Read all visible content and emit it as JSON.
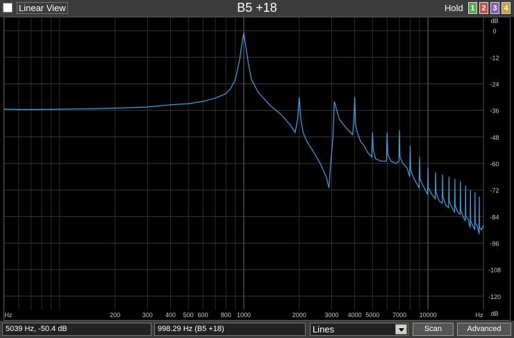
{
  "window": {
    "title": "B5 +18"
  },
  "toolbar": {
    "linear_view_label": "Linear View",
    "hold_label": "Hold",
    "hold_buttons": [
      {
        "label": "1",
        "color": "#5aa650"
      },
      {
        "label": "2",
        "color": "#c0504d"
      },
      {
        "label": "3",
        "color": "#7a60b0"
      },
      {
        "label": "4",
        "color": "#c9a03c"
      }
    ]
  },
  "chart_data": {
    "type": "line",
    "x_scale": "log",
    "xlim": [
      50,
      20000
    ],
    "ylim": [
      -126,
      6
    ],
    "x_tick_labels": [
      "Hz",
      "200",
      "300",
      "400",
      "500",
      "600",
      "800",
      "1000",
      "2000",
      "3000",
      "4000",
      "5000",
      "7000",
      "10000",
      "Hz"
    ],
    "x_tick_values": [
      null,
      200,
      300,
      400,
      500,
      600,
      800,
      1000,
      2000,
      3000,
      4000,
      5000,
      7000,
      10000,
      null
    ],
    "y_tick_labels": [
      "dB",
      "0",
      "-12",
      "-24",
      "-36",
      "-48",
      "-60",
      "-72",
      "-84",
      "-96",
      "-108",
      "-120",
      "dB"
    ],
    "y_tick_values": [
      null,
      0,
      -12,
      -24,
      -36,
      -48,
      -60,
      -72,
      -84,
      -96,
      -108,
      -120,
      null
    ],
    "grid": true,
    "line_color": "#3ea6e8",
    "series": [
      {
        "x": [
          50,
          60,
          80,
          100,
          150,
          200,
          300,
          400,
          500,
          600,
          700,
          800,
          850,
          900,
          950,
          980,
          1000,
          1020,
          1060,
          1100,
          1200,
          1400,
          1600,
          1800,
          1900,
          1960,
          2000,
          2040,
          2100,
          2200,
          2400,
          2600,
          2800,
          2900,
          2950,
          3000,
          3050,
          3100,
          3300,
          3600,
          3900,
          3960,
          4000,
          4040,
          4100,
          4300,
          4500,
          4700,
          4950,
          5000,
          5050,
          5200,
          5600,
          5950,
          6000,
          6050,
          6300,
          6700,
          6950,
          7000,
          7050,
          7300,
          7700,
          7950,
          8000,
          8050,
          8400,
          8950,
          9000,
          9050,
          9400,
          9950,
          10000,
          10050,
          10500,
          10950,
          11000,
          11050,
          11500,
          11950,
          12000,
          12050,
          12500,
          12950,
          13000,
          13050,
          13500,
          13950,
          14000,
          14050,
          14500,
          14950,
          15000,
          15050,
          15500,
          15950,
          16000,
          16050,
          16500,
          16950,
          17000,
          17050,
          17500,
          17950,
          18000,
          18050,
          18500,
          18950,
          19000,
          19050,
          19500,
          20000
        ],
        "y": [
          -35.5,
          -35.6,
          -35.6,
          -35.5,
          -35.3,
          -35.0,
          -34.5,
          -33.5,
          -33.0,
          -32.0,
          -30.5,
          -28.5,
          -26,
          -22,
          -13,
          -5,
          -1,
          -6,
          -15,
          -22,
          -28,
          -34,
          -38,
          -43,
          -46,
          -40,
          -30,
          -40,
          -46,
          -50,
          -55,
          -60,
          -66,
          -71,
          -62,
          -55,
          -48,
          -32,
          -40,
          -44,
          -47,
          -40,
          -30,
          -42,
          -45,
          -50,
          -52,
          -55,
          -57,
          -46,
          -54,
          -58,
          -59,
          -59,
          -46,
          -56,
          -59,
          -60,
          -59,
          -45,
          -57,
          -60,
          -62,
          -66,
          -52,
          -63,
          -67,
          -71,
          -57,
          -67,
          -70,
          -74,
          -62,
          -71,
          -74,
          -76,
          -64,
          -73,
          -77,
          -78,
          -65,
          -75,
          -79,
          -80,
          -66,
          -77,
          -80,
          -82,
          -67,
          -79,
          -82,
          -83,
          -68,
          -81,
          -84,
          -86,
          -70,
          -84,
          -85,
          -89,
          -72,
          -86,
          -88,
          -90,
          -73,
          -87,
          -88,
          -92,
          -75,
          -89,
          -90,
          -88
        ]
      }
    ]
  },
  "status": {
    "cursor_readout": "5039 Hz,  -50.4 dB",
    "peak_readout": "998.29 Hz (B5 +18)"
  },
  "display_mode": {
    "selected": "Lines"
  },
  "buttons": {
    "scan": "Scan",
    "advanced": "Advanced"
  }
}
